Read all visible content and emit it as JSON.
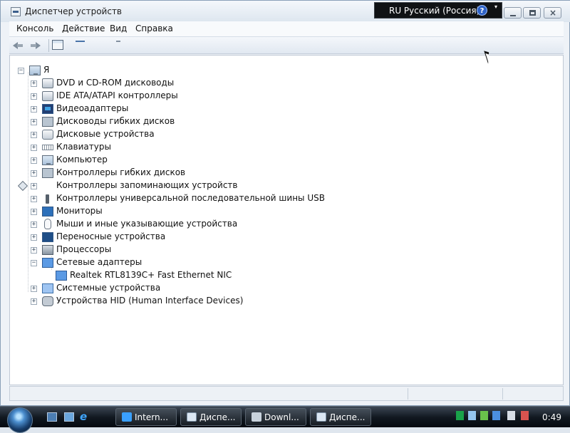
{
  "window": {
    "title": "Диспетчер устройств",
    "language_bar": "RU Русский (Россия)",
    "help": "?"
  },
  "menu": [
    "Консоль",
    "Действие",
    "Вид",
    "Справка"
  ],
  "tree": {
    "root": "Я",
    "items": [
      {
        "label": "DVD и CD-ROM дисководы",
        "expander": "+",
        "icon": "optical-drive-icon"
      },
      {
        "label": "IDE ATA/ATAPI контроллеры",
        "expander": "+",
        "icon": "ide-controller-icon"
      },
      {
        "label": "Видеоадаптеры",
        "expander": "+",
        "icon": "display-adapter-icon"
      },
      {
        "label": "Дисководы гибких дисков",
        "expander": "+",
        "icon": "floppy-drive-icon"
      },
      {
        "label": "Дисковые устройства",
        "expander": "+",
        "icon": "disk-drive-icon"
      },
      {
        "label": "Клавиатуры",
        "expander": "+",
        "icon": "keyboard-icon"
      },
      {
        "label": "Компьютер",
        "expander": "+",
        "icon": "computer-icon"
      },
      {
        "label": "Контроллеры гибких дисков",
        "expander": "+",
        "icon": "floppy-controller-icon"
      },
      {
        "label": "Контроллеры запоминающих устройств",
        "expander": "+",
        "icon": "storage-controller-icon"
      },
      {
        "label": "Контроллеры универсальной последовательной шины USB",
        "expander": "+",
        "icon": "usb-icon"
      },
      {
        "label": "Мониторы",
        "expander": "+",
        "icon": "monitor-icon"
      },
      {
        "label": "Мыши и иные указывающие устройства",
        "expander": "+",
        "icon": "mouse-icon"
      },
      {
        "label": "Переносные устройства",
        "expander": "+",
        "icon": "portable-device-icon"
      },
      {
        "label": "Процессоры",
        "expander": "+",
        "icon": "processor-icon"
      },
      {
        "label": "Сетевые адаптеры",
        "expander": "−",
        "icon": "network-adapter-icon"
      },
      {
        "label": "Realtek RTL8139C+ Fast Ethernet NIC",
        "expander": "",
        "icon": "network-card-icon"
      },
      {
        "label": "Системные устройства",
        "expander": "+",
        "icon": "system-device-icon"
      },
      {
        "label": "Устройства HID (Human Interface Devices)",
        "expander": "+",
        "icon": "hid-device-icon"
      }
    ]
  },
  "taskbar": {
    "buttons": [
      "Intern...",
      "Диспе...",
      "Downl...",
      "Диспе..."
    ],
    "time": "0:49"
  },
  "colors": {
    "window_bg": "#eef2f7",
    "content_bg": "#ffffff",
    "taskbar_bg": "#111820",
    "accent": "#2f63c7"
  }
}
